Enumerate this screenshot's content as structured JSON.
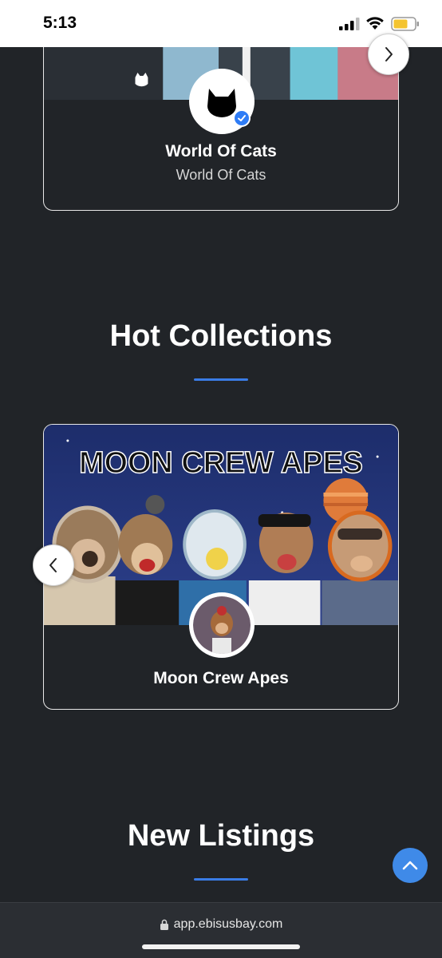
{
  "status_bar": {
    "time": "5:13"
  },
  "featured": {
    "title": "World Of Cats",
    "subtitle": "World Of Cats"
  },
  "hot_collections": {
    "heading": "Hot Collections",
    "banner_text": "MOON CREW APES",
    "title": "Moon Crew Apes"
  },
  "new_listings": {
    "heading": "New Listings"
  },
  "browser": {
    "url": "app.ebisusbay.com"
  },
  "colors": {
    "background": "#212428",
    "accent": "#3a7ce6",
    "verified": "#2e7cf6",
    "scroll_button": "#3f8ae8"
  },
  "icons": {
    "verified": "check-icon",
    "next": "chevron-right-icon",
    "prev": "chevron-left-icon",
    "scroll_top": "chevron-up-icon",
    "lock": "lock-icon"
  }
}
